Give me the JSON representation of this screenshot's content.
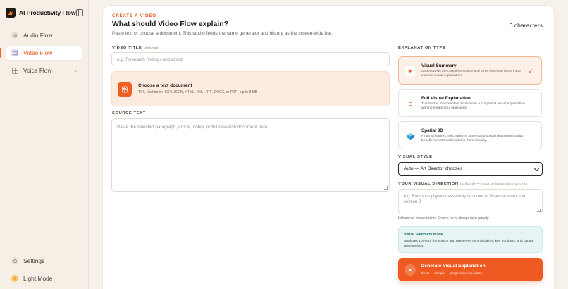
{
  "app": {
    "name": "AI Productivity Flow"
  },
  "sidebar": {
    "items": [
      {
        "label": "Audio Flow",
        "icon": "audio-wave-icon"
      },
      {
        "label": "Video Flow",
        "icon": "video-icon"
      },
      {
        "label": "Voice Flow",
        "icon": "grid-icon"
      }
    ],
    "bottom": [
      {
        "label": "Settings",
        "icon": "gear-icon"
      },
      {
        "label": "Light Mode",
        "icon": "sun-icon"
      }
    ]
  },
  "header": {
    "eyebrow": "CREATE A VIDEO",
    "title": "What should Video Flow explain?",
    "subtitle": "Paste text or choose a document. This studio feeds the same generator and history as the screen-wide bar.",
    "char_count": "0 characters"
  },
  "form": {
    "video_title_label": "VIDEO TITLE",
    "video_title_optional": "optional",
    "video_title_placeholder": "e.g. Research findings explained",
    "upload_title": "Choose a text document",
    "upload_subtitle": "TXT, Markdown, CSV, JSON, HTML, XML, RTF, DOCX, or PDF · up to 8 MB",
    "source_label": "SOURCE TEXT",
    "source_placeholder": "Paste the selected paragraph, article, notes, or full research document here..."
  },
  "explanation": {
    "label": "EXPLANATION TYPE",
    "options": [
      {
        "title": "Visual Summary",
        "desc": "Understands the complete source and turns essential ideas into a concise visual explanation.",
        "selected": true
      },
      {
        "title": "Full Visual Explanation",
        "desc": "Transforms the complete source into a chaptered visual explanation with no meaningful omissions.",
        "selected": false
      },
      {
        "title": "Spatial 3D",
        "desc": "Finds structures, mechanisms, layers and spatial relationships that benefit from 3D and explains them visually.",
        "selected": false
      }
    ]
  },
  "style": {
    "label": "VISUAL STYLE",
    "selected": "Auto — Art Director chooses"
  },
  "direction": {
    "label": "YOUR VISUAL DIRECTION",
    "optional": "optional — source facts take priority",
    "placeholder": "e.g. Focus on physical assembly structure or financial metrics in section 2",
    "note": "Influences presentation. Source facts always take priority."
  },
  "mode": {
    "title": "Visual Summary mode",
    "desc": "Analyzes 100% of the source and preserves central claims, key numbers, and causal relationships."
  },
  "generate": {
    "title": "Generate Visual Explanation",
    "subtitle": "Direct — compile — progressive live watch"
  },
  "colors": {
    "accent": "#ef5a22",
    "mode_bg": "#e6f5f4",
    "upload_bg": "#fdebe0"
  }
}
